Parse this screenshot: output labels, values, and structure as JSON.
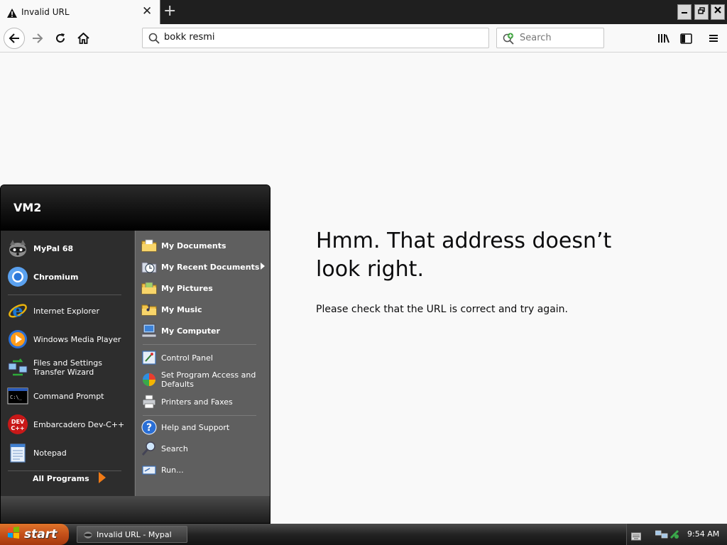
{
  "browser": {
    "tab_title": "Invalid URL",
    "url_value": "bokk resmi",
    "search_placeholder": "Search"
  },
  "page": {
    "error_title": "Hmm. That address doesn’t look right.",
    "error_message": "Please check that the URL is correct and try again."
  },
  "start_menu": {
    "user_name": "VM2",
    "pinned": [
      {
        "label": "MyPal 68",
        "icon": "raccoon-icon"
      },
      {
        "label": "Chromium",
        "icon": "chromium-icon"
      }
    ],
    "recent": [
      {
        "label": "Internet Explorer",
        "icon": "internet-explorer-icon"
      },
      {
        "label": "Windows Media Player",
        "icon": "media-player-icon"
      },
      {
        "label": "Files and Settings Transfer Wizard",
        "icon": "transfer-wizard-icon"
      },
      {
        "label": "Command Prompt",
        "icon": "command-prompt-icon"
      },
      {
        "label": "Embarcadero Dev-C++",
        "icon": "dev-cpp-icon"
      },
      {
        "label": "Notepad",
        "icon": "notepad-icon"
      }
    ],
    "all_programs_label": "All Programs",
    "places": [
      {
        "label": "My Documents",
        "icon": "folder-documents-icon"
      },
      {
        "label": "My Recent Documents",
        "icon": "recent-documents-icon"
      },
      {
        "label": "My Pictures",
        "icon": "folder-pictures-icon"
      },
      {
        "label": "My Music",
        "icon": "folder-music-icon"
      },
      {
        "label": "My Computer",
        "icon": "computer-icon"
      }
    ],
    "settings": [
      {
        "label": "Control Panel",
        "icon": "control-panel-icon"
      },
      {
        "label": "Set Program Access and Defaults",
        "icon": "program-defaults-icon"
      },
      {
        "label": "Printers and Faxes",
        "icon": "printer-icon"
      }
    ],
    "tools": [
      {
        "label": "Help and Support",
        "icon": "help-icon"
      },
      {
        "label": "Search",
        "icon": "search-icon"
      },
      {
        "label": "Run...",
        "icon": "run-icon"
      }
    ]
  },
  "taskbar": {
    "start_label": "start",
    "task_label": "Invalid URL - Mypal",
    "clock": "9:54 AM"
  },
  "colors": {
    "page_background": "#f9f9f9",
    "tabbar_background": "#1f1f1f",
    "start_button": "#c4501a",
    "start_menu_left": "#2d2d2d",
    "start_menu_right": "#5f5f5f"
  }
}
